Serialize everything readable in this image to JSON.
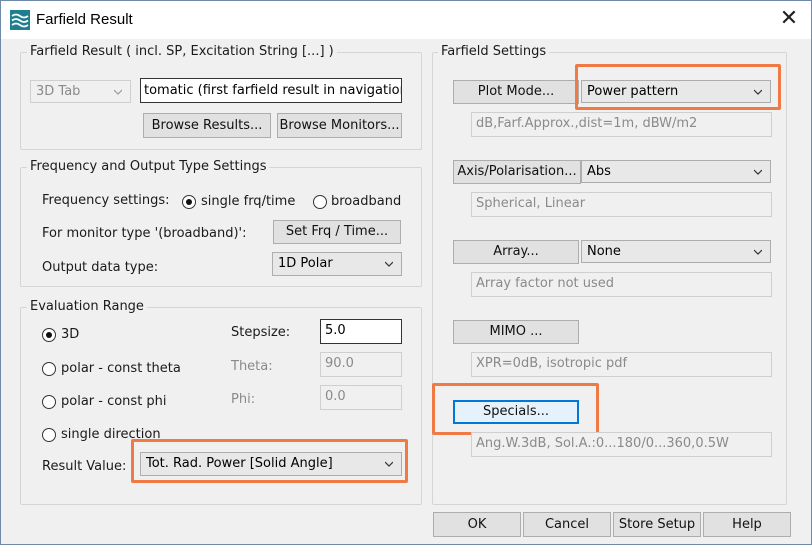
{
  "window": {
    "title": "Farfield Result",
    "close_glyph": "✕",
    "icon": "app-wave-icon"
  },
  "result_group": {
    "label": "Farfield Result ( incl. SP, Excitation String [...] )",
    "tab_select": "3D Tab",
    "result_field": "tomatic (first farfield result in navigation tree)",
    "browse_results": "Browse Results...",
    "browse_monitors": "Browse Monitors..."
  },
  "freq_group": {
    "label": "Frequency and Output Type Settings",
    "freq_label": "Frequency settings:",
    "single_label": "single frq/time",
    "broadband_label": "broadband",
    "selected": "single frq/time",
    "monitor_label": "For monitor type '(broadband)':",
    "set_frq_button": "Set Frq / Time...",
    "output_label": "Output data type:",
    "output_value": "1D Polar"
  },
  "eval_group": {
    "label": "Evaluation Range",
    "opt_3d": "3D",
    "opt_polar_theta": "polar - const theta",
    "opt_polar_phi": "polar - const phi",
    "opt_single": "single direction",
    "selected": "3D",
    "stepsize_label": "Stepsize:",
    "stepsize_value": "5.0",
    "theta_label": "Theta:",
    "theta_value": "90.0",
    "phi_label": "Phi:",
    "phi_value": "0.0",
    "result_label": "Result Value:",
    "result_value": "Tot. Rad. Power [Solid Angle]"
  },
  "farfield_settings": {
    "label": "Farfield Settings",
    "plot_mode_button": "Plot Mode...",
    "plot_mode_value": "Power pattern",
    "plot_mode_info": "dB,Farf.Approx.,dist=1m, dBW/m2",
    "axis_button": "Axis/Polarisation...",
    "axis_value": "Abs",
    "axis_info": "Spherical, Linear",
    "array_button": "Array...",
    "array_value": "None",
    "array_info": "Array factor not used",
    "mimo_button": "MIMO ...",
    "mimo_info": "XPR=0dB, isotropic pdf",
    "specials_button": "Specials...",
    "specials_info": "Ang.W.3dB, Sol.A.:0...180/0...360,0.5W"
  },
  "footer": {
    "ok": "OK",
    "cancel": "Cancel",
    "store_setup": "Store Setup",
    "help": "Help"
  },
  "colors": {
    "highlight": "#f07a45",
    "default_button_border": "#0078d7",
    "dialog_bg": "#f0f0f0"
  }
}
